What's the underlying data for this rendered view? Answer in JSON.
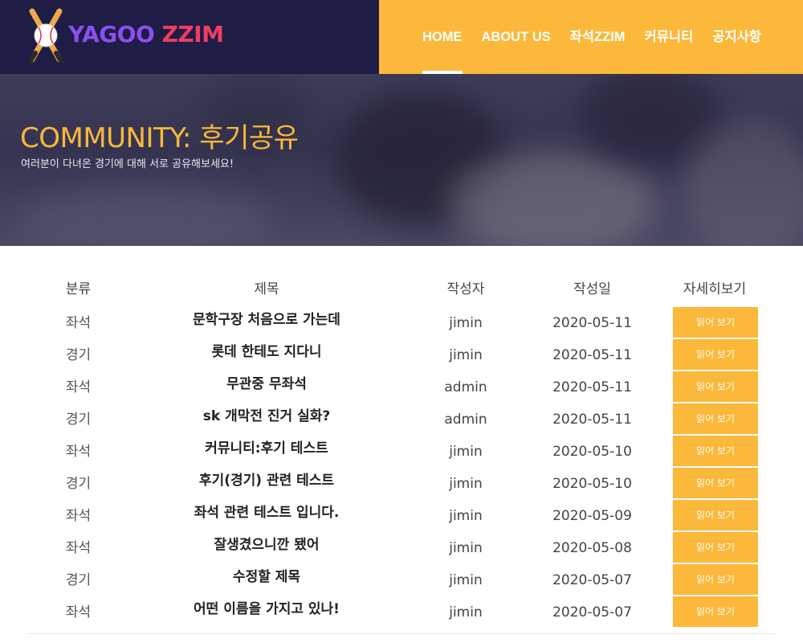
{
  "brand": {
    "part1": "YAGOO ",
    "part2": "ZZIM"
  },
  "colors": {
    "navy": "#1f1c45",
    "accent": "#fbb83a",
    "brand_purple": "#8a4ff0",
    "brand_red": "#ef3d63"
  },
  "nav": {
    "items": [
      {
        "label": "HOME",
        "active": true
      },
      {
        "label": "ABOUT US"
      },
      {
        "label": "좌석ZZIM"
      },
      {
        "label": "커뮤니티"
      },
      {
        "label": "공지사항"
      }
    ]
  },
  "hero": {
    "title": "COMMUNITY: 후기공유",
    "subtitle": "여러분이 다녀온 경기에 대해 서로 공유해보세요!"
  },
  "table": {
    "headers": {
      "category": "분류",
      "title": "제목",
      "author": "작성자",
      "date": "작성일",
      "detail": "자세히보기"
    },
    "button_label": "읽어 보기",
    "rows": [
      {
        "category": "좌석",
        "title": "문학구장 처음으로 가는데",
        "author": "jimin",
        "date": "2020-05-11"
      },
      {
        "category": "경기",
        "title": "롯데 한테도 지다니",
        "author": "jimin",
        "date": "2020-05-11"
      },
      {
        "category": "좌석",
        "title": "무관중 무좌석",
        "author": "admin",
        "date": "2020-05-11"
      },
      {
        "category": "경기",
        "title": "sk 개막전 진거 실화?",
        "author": "admin",
        "date": "2020-05-11"
      },
      {
        "category": "좌석",
        "title": "커뮤니티:후기 테스트",
        "author": "jimin",
        "date": "2020-05-10"
      },
      {
        "category": "경기",
        "title": "후기(경기) 관련 테스트",
        "author": "jimin",
        "date": "2020-05-10"
      },
      {
        "category": "좌석",
        "title": "좌석 관련 테스트 입니다.",
        "author": "jimin",
        "date": "2020-05-09"
      },
      {
        "category": "좌석",
        "title": "잘생겼으니깐 됐어",
        "author": "jimin",
        "date": "2020-05-08"
      },
      {
        "category": "경기",
        "title": "수정할 제목",
        "author": "jimin",
        "date": "2020-05-07"
      },
      {
        "category": "좌석",
        "title": "어떤 이름을 가지고 있나!",
        "author": "jimin",
        "date": "2020-05-07"
      }
    ]
  }
}
